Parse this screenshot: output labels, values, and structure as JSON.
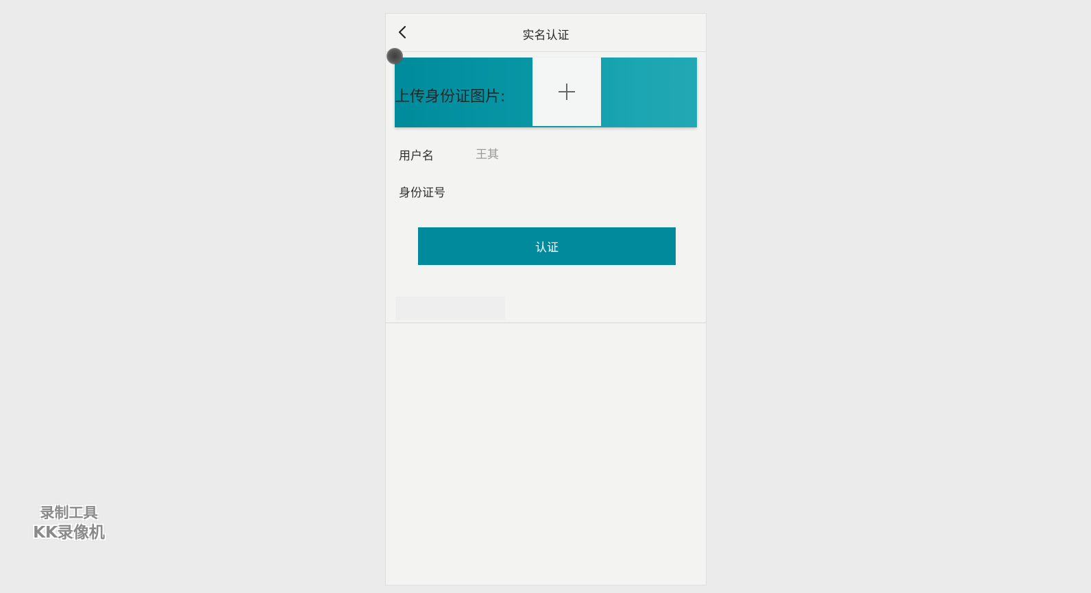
{
  "navbar": {
    "title": "实名认证",
    "back_icon": "chevron-left-icon"
  },
  "upload": {
    "label": "上传身份证图片:",
    "add_icon": "plus-icon"
  },
  "form": {
    "username_label": "用户名",
    "username_value": "王其",
    "id_label": "身份证号",
    "id_value": ""
  },
  "submit": {
    "label": "认证"
  },
  "watermark": {
    "line1": "录制工具",
    "line2": "KK录像机"
  },
  "colors": {
    "accent": "#008a9c",
    "background": "#ebebeb",
    "panel": "#f3f3f2"
  }
}
